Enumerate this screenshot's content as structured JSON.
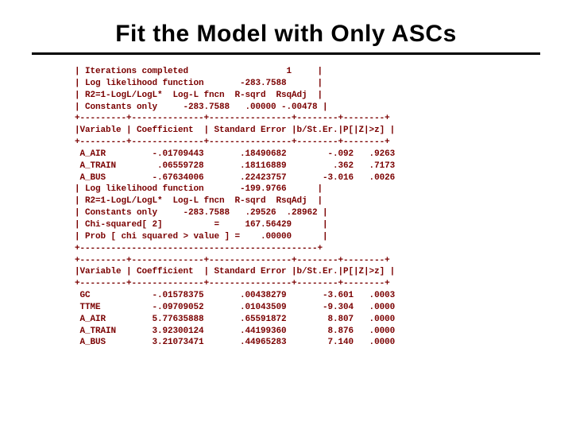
{
  "title": "Fit the Model with Only ASCs",
  "lines": [
    "| Iterations completed                   1     |",
    "| Log likelihood function       -283.7588      |",
    "| R2=1-LogL/LogL*  Log-L fncn  R-sqrd  RsqAdj  |",
    "| Constants only     -283.7588   .00000 -.00478 |",
    "+---------+--------------+----------------+--------+--------+",
    "|Variable | Coefficient  | Standard Error |b/St.Er.|P[|Z|>z] |",
    "+---------+--------------+----------------+--------+--------+",
    " A_AIR         -.01709443       .18490682        -.092   .9263",
    " A_TRAIN        .06559728       .18116889         .362   .7173",
    " A_BUS         -.67634006       .22423757       -3.016   .0026",
    "| Log likelihood function       -199.9766      |",
    "| R2=1-LogL/LogL*  Log-L fncn  R-sqrd  RsqAdj  |",
    "| Constants only     -283.7588   .29526  .28962 |",
    "| Chi-squared[ 2]          =     167.56429      |",
    "| Prob [ chi squared > value ] =    .00000      |",
    "+----------------------------------------------+",
    "+---------+--------------+----------------+--------+--------+",
    "|Variable | Coefficient  | Standard Error |b/St.Er.|P[|Z|>z] |",
    "+---------+--------------+----------------+--------+--------+",
    " GC            -.01578375       .00438279       -3.601   .0003",
    " TTME          -.09709052       .01043509       -9.304   .0000",
    " A_AIR         5.77635888       .65591872        8.807   .0000",
    " A_TRAIN       3.92300124       .44199360        8.876   .0000",
    " A_BUS         3.21073471       .44965283        7.140   .0000"
  ],
  "chart_data": {
    "type": "table",
    "title": "Fit the Model with Only ASCs",
    "sections": [
      {
        "name": "model_fit_asc_only",
        "stats": {
          "iterations_completed": 1,
          "log_likelihood": -283.7588,
          "constants_only_logL": -283.7588,
          "r_sqrd": 0.0,
          "rsq_adj": -0.00478
        },
        "columns": [
          "Variable",
          "Coefficient",
          "Standard Error",
          "b/St.Er.",
          "P[|Z|>z]"
        ],
        "rows": [
          {
            "Variable": "A_AIR",
            "Coefficient": -0.01709443,
            "Standard Error": 0.18490682,
            "b/St.Er.": -0.092,
            "P": 0.9263
          },
          {
            "Variable": "A_TRAIN",
            "Coefficient": 0.06559728,
            "Standard Error": 0.18116889,
            "b/St.Er.": 0.362,
            "P": 0.7173
          },
          {
            "Variable": "A_BUS",
            "Coefficient": -0.67634006,
            "Standard Error": 0.22423757,
            "b/St.Er.": -3.016,
            "P": 0.0026
          }
        ]
      },
      {
        "name": "model_fit_full",
        "stats": {
          "log_likelihood": -199.9766,
          "constants_only_logL": -283.7588,
          "r_sqrd": 0.29526,
          "rsq_adj": 0.28962,
          "chi_squared_df2": 167.56429,
          "prob_chi_sq": 0.0
        },
        "columns": [
          "Variable",
          "Coefficient",
          "Standard Error",
          "b/St.Er.",
          "P[|Z|>z]"
        ],
        "rows": [
          {
            "Variable": "GC",
            "Coefficient": -0.01578375,
            "Standard Error": 0.00438279,
            "b/St.Er.": -3.601,
            "P": 0.0003
          },
          {
            "Variable": "TTME",
            "Coefficient": -0.09709052,
            "Standard Error": 0.01043509,
            "b/St.Er.": -9.304,
            "P": 0.0
          },
          {
            "Variable": "A_AIR",
            "Coefficient": 5.77635888,
            "Standard Error": 0.65591872,
            "b/St.Er.": 8.807,
            "P": 0.0
          },
          {
            "Variable": "A_TRAIN",
            "Coefficient": 3.92300124,
            "Standard Error": 0.4419936,
            "b/St.Er.": 8.876,
            "P": 0.0
          },
          {
            "Variable": "A_BUS",
            "Coefficient": 3.21073471,
            "Standard Error": 0.44965283,
            "b/St.Er.": 7.14,
            "P": 0.0
          }
        ]
      }
    ]
  }
}
